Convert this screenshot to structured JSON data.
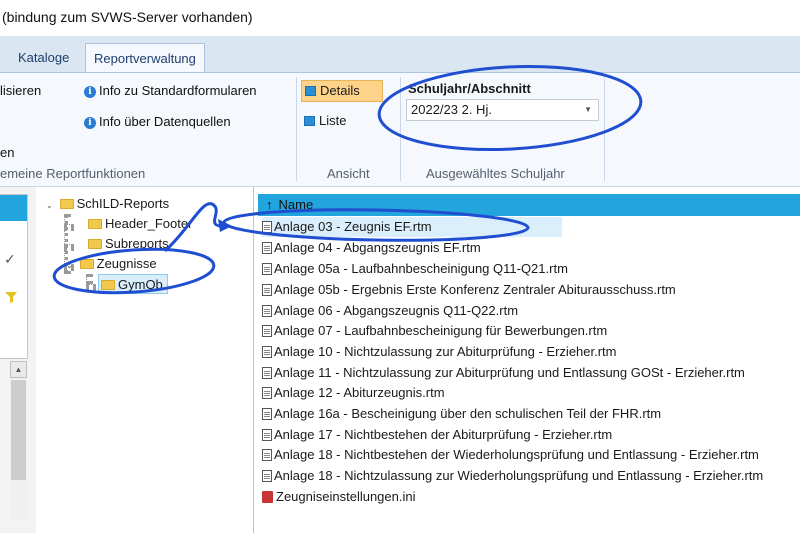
{
  "window": {
    "title": "(bindung zum SVWS-Server vorhanden)"
  },
  "tabs": [
    {
      "label": "Kataloge"
    },
    {
      "label": "Reportverwaltung"
    }
  ],
  "ribbon": {
    "general": {
      "item_partial_1": "lisieren",
      "item_partial_2": "en",
      "info_standard": "Info zu Standardformularen",
      "info_datasources": "Info über Datenquellen",
      "group_label": "emeine Reportfunktionen"
    },
    "view": {
      "details_label": "Details",
      "liste_label": "Liste",
      "group_label": "Ansicht"
    },
    "schoolyear": {
      "title": "Schuljahr/Abschnitt",
      "selected_value": "2022/23 2. Hj.",
      "group_label": "Ausgewähltes Schuljahr"
    }
  },
  "tree": {
    "root": "SchILD-Reports",
    "children": [
      "Header_Footer",
      "Subreports",
      "Zeugnisse"
    ],
    "selected_leaf": "GymOb"
  },
  "list": {
    "column_header": "Name",
    "files": [
      "Anlage 03 - Zeugnis EF.rtm",
      "Anlage 04 - Abgangszeugnis EF.rtm",
      "Anlage 05a - Laufbahnbescheinigung Q11-Q21.rtm",
      "Anlage 05b - Ergebnis Erste Konferenz Zentraler Abiturausschuss.rtm",
      "Anlage 06 - Abgangszeugnis Q11-Q22.rtm",
      "Anlage 07 - Laufbahnbescheinigung für Bewerbungen.rtm",
      "Anlage 10 - Nichtzulassung zur Abiturprüfung - Erzieher.rtm",
      "Anlage 11 - Nichtzulassung zur Abiturprüfung und Entlassung GOSt - Erzieher.rtm",
      "Anlage 12 - Abiturzeugnis.rtm",
      "Anlage 16a - Bescheinigung über den schulischen Teil der FHR.rtm",
      "Anlage 17 - Nichtbestehen der Abiturprüfung - Erzieher.rtm",
      "Anlage 18 - Nichtbestehen der Wiederholungsprüfung und Entlassung - Erzieher.rtm",
      "Anlage 18 - Nichtzulassung zur Wiederholungsprüfung und Entlassung - Erzieher.rtm"
    ],
    "ini_file": "Zeugniseinstellungen.ini"
  },
  "colors": {
    "accent_blue": "#22a4dc",
    "annotation_blue": "#1f4fd0",
    "details_highlight": "#fcd389",
    "folder_yellow": "#f2c94c"
  }
}
